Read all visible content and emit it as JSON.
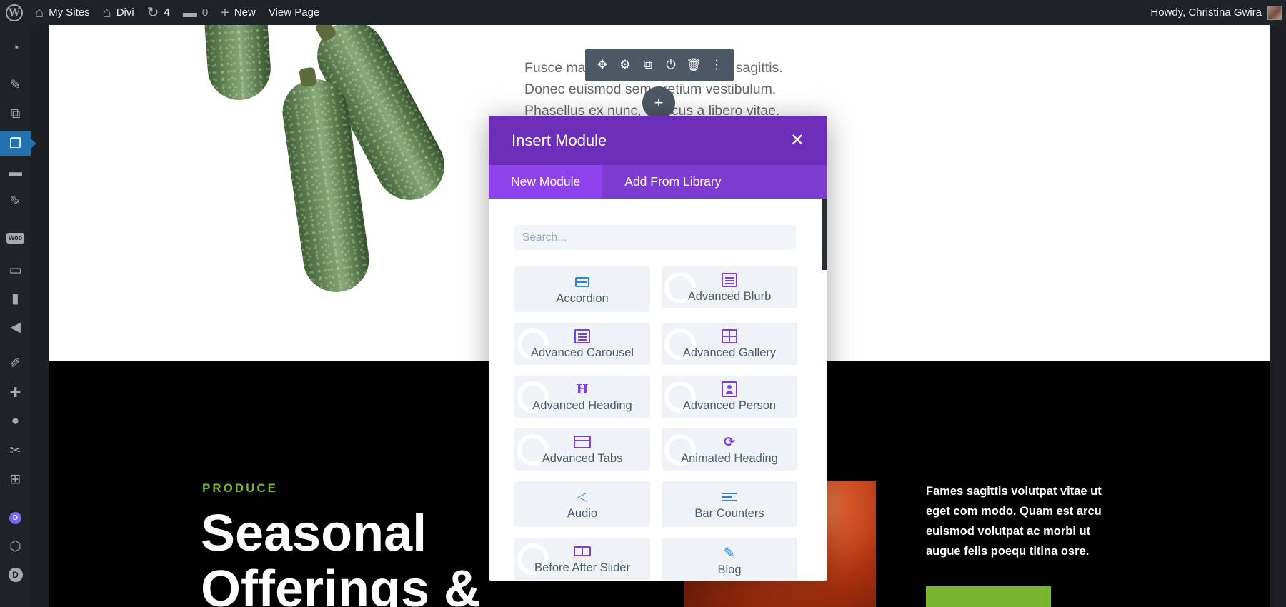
{
  "admin_bar": {
    "my_sites": "My Sites",
    "site_name": "Divi",
    "updates_count": "4",
    "comments_count": "0",
    "new_label": "New",
    "view_page": "View Page",
    "greeting": "Howdy, Christina Gwira"
  },
  "admin_menu": {
    "icons": [
      "dashboard-icon",
      "posts-icon",
      "media-icon",
      "pages-icon",
      "comments-icon",
      "pin-icon",
      "woocommerce-icon",
      "products-icon",
      "analytics-icon",
      "marketing-icon",
      "appearance-icon",
      "plugins-icon",
      "users-icon",
      "tools-icon",
      "settings-icon",
      "divi-icon",
      "hexagon-icon",
      "d-icon"
    ],
    "woo_label": "Woo",
    "d_label": "D"
  },
  "page": {
    "body_text_line1": "Fusce ma",
    "body_text_line1_end": "sagittis.",
    "body_text_line2": "Donec euismod sem pretium vestibulum.",
    "body_text_line3": "Phasellus ex nunc,",
    "body_text_line3_end": "cus a libero vitae.",
    "produce_label": "PRODUCE",
    "produce_heading": "Seasonal Offerings &",
    "right_paragraph": "Fames sagittis volutpat vitae ut eget com modo. Quam est arcu euismod volutpat ac morbi ut augue felis poequ titina osre."
  },
  "module_toolbar": {
    "buttons": [
      "move-icon",
      "settings-icon",
      "duplicate-icon",
      "power-icon",
      "delete-icon",
      "more-icon"
    ]
  },
  "insert_module": {
    "title": "Insert Module",
    "tabs": [
      {
        "label": "New Module",
        "active": true
      },
      {
        "label": "Add From Library",
        "active": false
      }
    ],
    "search_placeholder": "Search...",
    "modules": [
      {
        "label": "Accordion",
        "icon": "accordion-icon"
      },
      {
        "label": "Advanced Blurb",
        "icon": "advanced-blurb-icon"
      },
      {
        "label": "Advanced Carousel",
        "icon": "advanced-carousel-icon"
      },
      {
        "label": "Advanced Gallery",
        "icon": "advanced-gallery-icon"
      },
      {
        "label": "Advanced Heading",
        "icon": "advanced-heading-icon"
      },
      {
        "label": "Advanced Person",
        "icon": "advanced-person-icon"
      },
      {
        "label": "Advanced Tabs",
        "icon": "advanced-tabs-icon"
      },
      {
        "label": "Animated Heading",
        "icon": "animated-heading-icon"
      },
      {
        "label": "Audio",
        "icon": "audio-icon"
      },
      {
        "label": "Bar Counters",
        "icon": "bar-counters-icon"
      },
      {
        "label": "Before After Slider",
        "icon": "before-after-slider-icon"
      },
      {
        "label": "Blog",
        "icon": "blog-icon"
      }
    ]
  },
  "colors": {
    "admin_bar_bg": "#1d2327",
    "modal_header": "#6c2eb9",
    "modal_tabs": "#7e3bd0",
    "active_tab": "#8f42ec",
    "produce_green": "#7ab530"
  }
}
